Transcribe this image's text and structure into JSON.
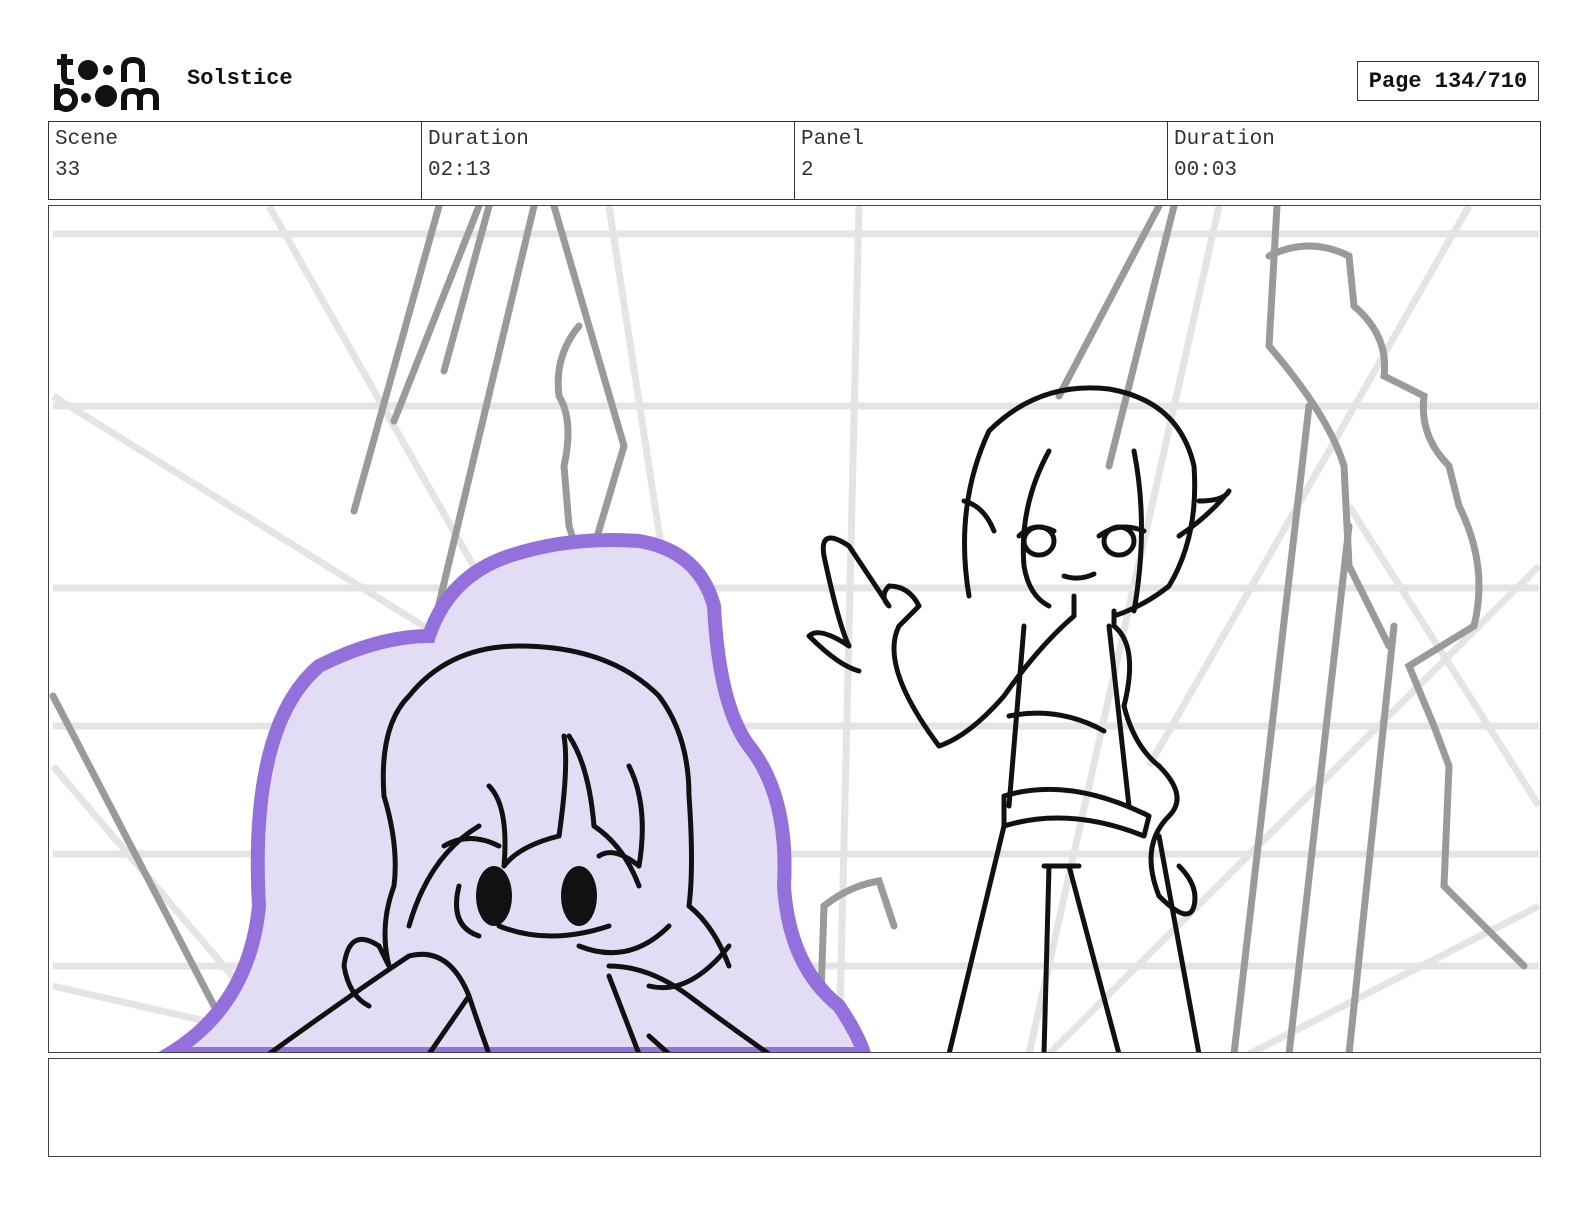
{
  "header": {
    "logo_icon": "toon-boom-logo",
    "project_title": "Solstice",
    "page_label": "Page 134/710"
  },
  "info": [
    {
      "label": "Scene",
      "value": "33"
    },
    {
      "label": "Duration",
      "value": "02:13"
    },
    {
      "label": "Panel",
      "value": "2"
    },
    {
      "label": "Duration",
      "value": "00:03"
    }
  ],
  "panel": {
    "image_icon": "storyboard-sketch-image",
    "colors": {
      "background_grid": "#e4e4e4",
      "mid_lines": "#9a9a9a",
      "ink": "#111111",
      "aura_fill": "#e3dcf5",
      "aura_stroke": "#9370db"
    }
  },
  "notes": {
    "text": ""
  }
}
